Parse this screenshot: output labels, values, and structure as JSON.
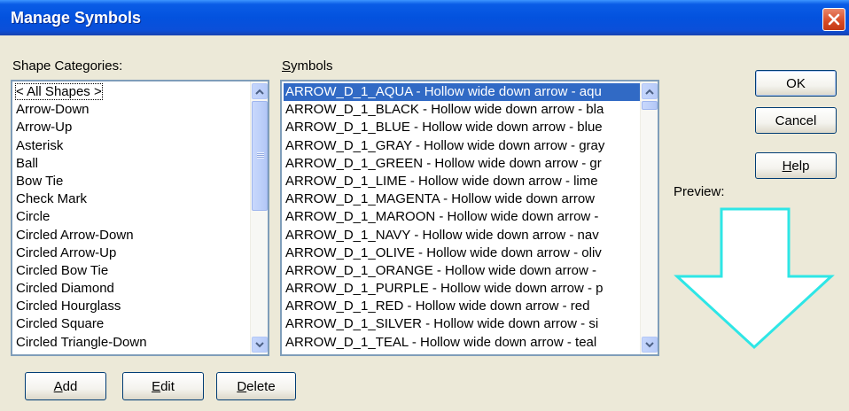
{
  "window": {
    "title": "Manage Symbols"
  },
  "categories": {
    "label_accel": "",
    "label_rest": "Shape Categories:",
    "items": [
      "< All Shapes >",
      "Arrow-Down",
      "Arrow-Up",
      "Asterisk",
      "Ball",
      "Bow Tie",
      "Check Mark",
      "Circle",
      "Circled Arrow-Down",
      "Circled Arrow-Up",
      "Circled Bow Tie",
      "Circled Diamond",
      "Circled Hourglass",
      "Circled Square",
      "Circled Triangle-Down"
    ]
  },
  "symbols": {
    "label_accel": "S",
    "label_rest": "ymbols",
    "items": [
      "ARROW_D_1_AQUA - Hollow wide down arrow - aqu",
      "ARROW_D_1_BLACK - Hollow wide down arrow - bla",
      "ARROW_D_1_BLUE - Hollow wide down arrow - blue",
      "ARROW_D_1_GRAY - Hollow wide down arrow - gray",
      "ARROW_D_1_GREEN - Hollow wide down arrow - gr",
      "ARROW_D_1_LIME - Hollow wide down arrow - lime",
      "ARROW_D_1_MAGENTA - Hollow wide down arrow",
      "ARROW_D_1_MAROON - Hollow wide down arrow -",
      "ARROW_D_1_NAVY - Hollow wide down arrow - nav",
      "ARROW_D_1_OLIVE - Hollow wide down arrow - oliv",
      "ARROW_D_1_ORANGE - Hollow wide down arrow -",
      "ARROW_D_1_PURPLE - Hollow wide down arrow - p",
      "ARROW_D_1_RED - Hollow wide down arrow - red",
      "ARROW_D_1_SILVER - Hollow wide down arrow - si",
      "ARROW_D_1_TEAL - Hollow wide down arrow - teal"
    ]
  },
  "buttons": {
    "ok": "OK",
    "cancel": "Cancel",
    "help_accel": "H",
    "help_rest": "elp",
    "add_accel": "A",
    "add_rest": "dd",
    "edit_accel": "E",
    "edit_rest": "dit",
    "delete_accel": "D",
    "delete_rest": "elete"
  },
  "preview": {
    "label": "Preview:",
    "arrow_color": "#2EE6E6",
    "icon": "hollow-down-arrow-icon"
  },
  "colors": {
    "titlebar": "#0352DE",
    "selection": "#316AC5",
    "dialog_bg": "#ECE9D8"
  }
}
